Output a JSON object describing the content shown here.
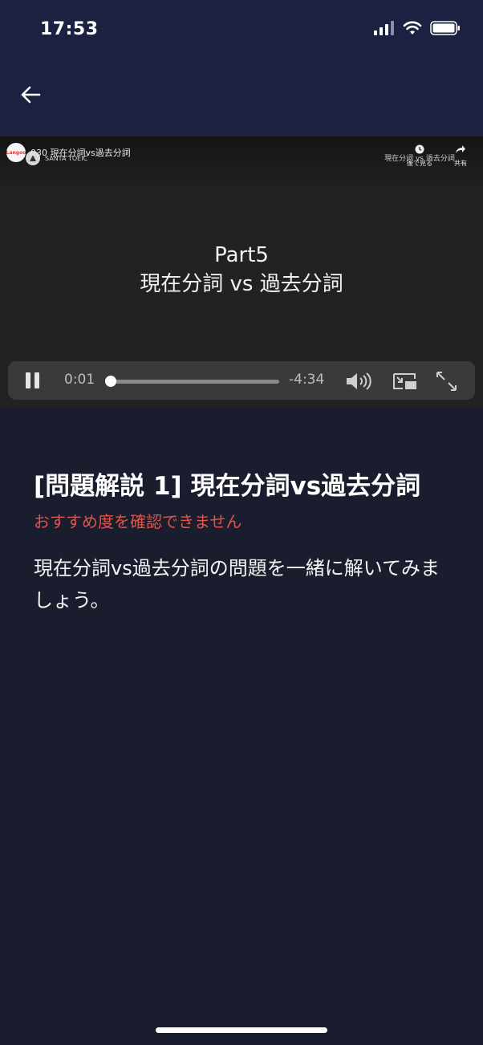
{
  "status_bar": {
    "time": "17:53"
  },
  "icons": {
    "back": "arrow-left-icon",
    "pause": "pause-icon",
    "volume": "volume-icon",
    "pip": "picture-in-picture-icon",
    "fullscreen": "fullscreen-icon",
    "watch_later": "clock-icon",
    "share": "share-icon"
  },
  "video": {
    "channel_logo": "Langoo",
    "title": "030 現在分詞vs過去分詞",
    "channel_name": "SANTA TOEIC",
    "watch_later_label": "後で見る",
    "watch_later_overlay": "現在分詞 vs 過去分詞",
    "share_label": "共有",
    "caption_line1": "Part5",
    "caption_line2": "現在分詞 vs 過去分詞",
    "elapsed": "0:01",
    "remaining": "-4:34",
    "progress": 0.004
  },
  "content": {
    "title": "[問題解説 1] 現在分詞vs過去分詞",
    "warning": "おすすめ度を確認できません",
    "description": "現在分詞vs過去分詞の問題を一緒に解いてみましょう。"
  },
  "colors": {
    "header_bg": "#1c2142",
    "page_bg": "#1a1d2d",
    "warning": "#e0544c"
  }
}
